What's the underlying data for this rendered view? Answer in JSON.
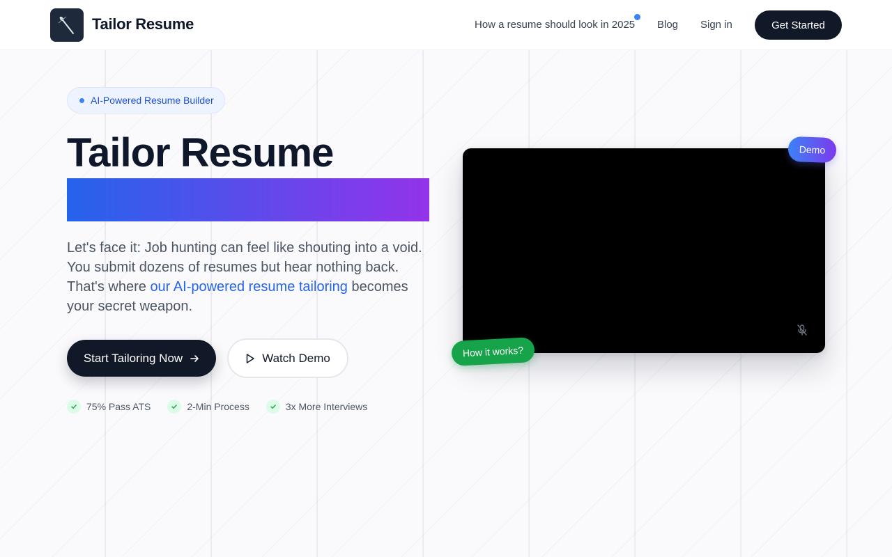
{
  "brand": {
    "name": "Tailor Resume",
    "logo_icon": "needle-icon"
  },
  "nav": {
    "links": [
      {
        "label": "How a resume should look in 2025"
      },
      {
        "label": "Blog"
      },
      {
        "label": "Sign in"
      }
    ],
    "cta_label": "Get Started"
  },
  "hero": {
    "badge": "AI-Powered Resume Builder",
    "title": "Tailor Resume",
    "desc_before": "Let's face it: Job hunting can feel like shouting into a void. You submit dozens of resumes but hear nothing back. That's where ",
    "desc_link": "our AI-powered resume tailoring",
    "desc_after": " becomes your secret weapon.",
    "primary_btn": "Start Tailoring Now",
    "secondary_btn": "Watch Demo",
    "stats": [
      {
        "label": "75% Pass ATS"
      },
      {
        "label": "2-Min Process"
      },
      {
        "label": "3x More Interviews"
      }
    ]
  },
  "video": {
    "demo_tag": "Demo",
    "how_tag": "How it works?"
  },
  "colors": {
    "accent_blue": "#2563eb",
    "accent_purple": "#9333ea",
    "dark": "#111827",
    "green": "#16a34a"
  }
}
